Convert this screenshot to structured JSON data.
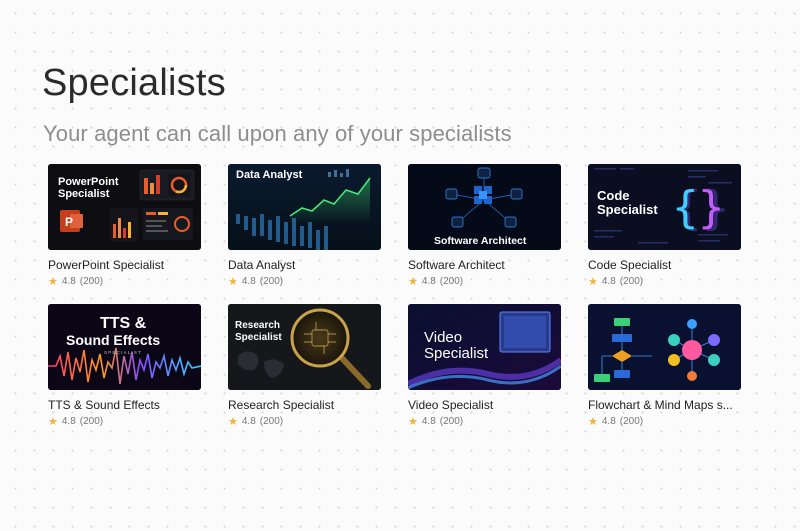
{
  "page": {
    "title": "Specialists",
    "subtitle": "Your agent can call upon any of your specialists"
  },
  "specialists": [
    {
      "name": "PowerPoint Specialist",
      "thumb_text": "PowerPoint Specialist",
      "rating": "4.8",
      "reviews": "(200)"
    },
    {
      "name": "Data Analyst",
      "thumb_text": "Data Analyst",
      "rating": "4.8",
      "reviews": "(200)"
    },
    {
      "name": "Software Architect",
      "thumb_text": "Software Architect",
      "rating": "4.8",
      "reviews": "(200)"
    },
    {
      "name": "Code Specialist",
      "thumb_text": "Code Specialist",
      "rating": "4.8",
      "reviews": "(200)"
    },
    {
      "name": "TTS & Sound Effects",
      "thumb_text": "TTS & Sound Effects",
      "rating": "4.8",
      "reviews": "(200)"
    },
    {
      "name": "Research Specialist",
      "thumb_text": "Research Specialist",
      "rating": "4.8",
      "reviews": "(200)"
    },
    {
      "name": "Video Specialist",
      "thumb_text": "Video Specialist",
      "rating": "4.8",
      "reviews": "(200)"
    },
    {
      "name": "Flowchart & Mind Maps s...",
      "thumb_text": "",
      "rating": "4.8",
      "reviews": "(200)"
    }
  ],
  "icons": {
    "rating": "star-icon"
  },
  "colors": {
    "star": "#f0b43a",
    "title": "#2b2b2b",
    "subtitle": "#8e8e8e"
  }
}
